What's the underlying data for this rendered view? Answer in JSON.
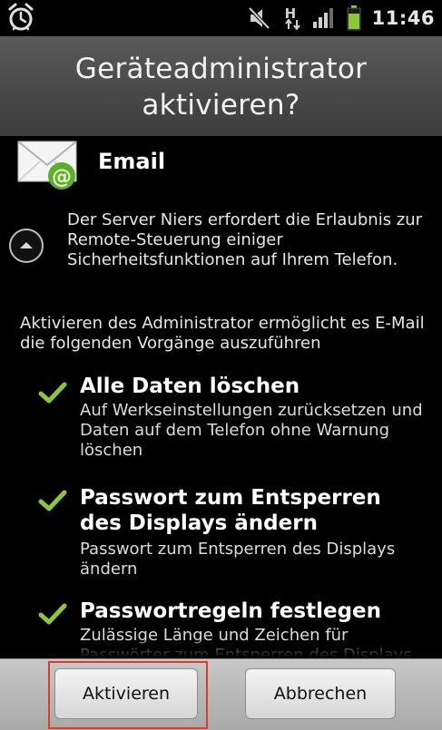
{
  "status_bar": {
    "time": "11:46",
    "network_label": "H",
    "icons": [
      "alarm-icon",
      "mute-icon",
      "data-hsdpa-icon",
      "signal-icon",
      "battery-icon"
    ]
  },
  "dialog": {
    "title_line1": "Geräteadministrator",
    "title_line2": "aktivieren?",
    "app": {
      "name": "Email",
      "icon": "email-app-icon"
    },
    "description": "Der Server Niers erfordert die Erlaubnis zur Remote-Steuerung einiger Sicherheitsfunktionen auf Ihrem Telefon.",
    "intro": "Aktivieren des Administrator ermöglicht es E-Mail die folgenden Vorgänge auszuführen",
    "permissions": [
      {
        "title": "Alle Daten löschen",
        "description": "Auf Werkseinstellungen zurücksetzen und Daten auf dem Telefon ohne Warnung löschen"
      },
      {
        "title": "Passwort zum Entsperren des Displays ändern",
        "description": "Passwort zum Entsperren des Displays ändern"
      },
      {
        "title": "Passwortregeln festlegen",
        "description": "Zulässige Länge und Zeichen für Passwörter zum Entsperren des Displays"
      }
    ]
  },
  "buttons": {
    "activate": "Aktivieren",
    "cancel": "Abbrechen"
  },
  "colors": {
    "check_green": "#8cc63f",
    "highlight_red": "#e23a2a",
    "title_bar": "#4a4a4a"
  }
}
